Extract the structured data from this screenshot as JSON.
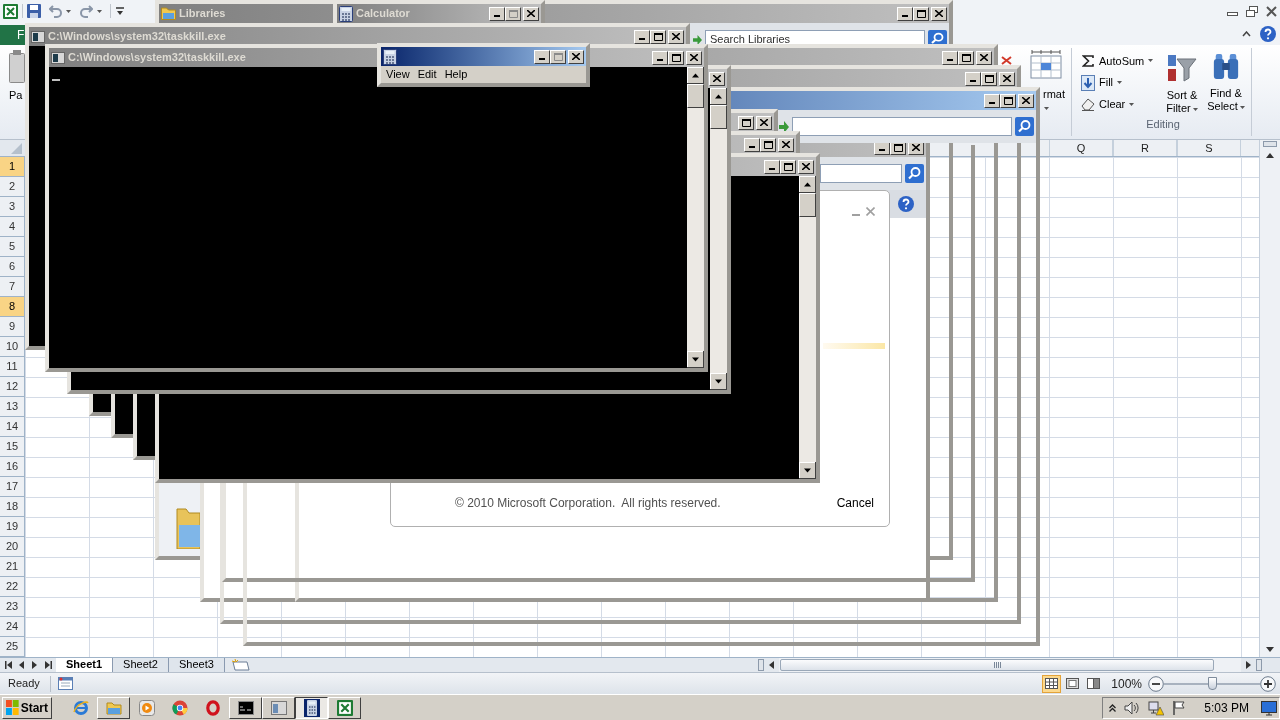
{
  "excel": {
    "file_tab": "F",
    "ribbon": {
      "paste_label": "Pa",
      "format_label": "rmat",
      "editing_items": [
        {
          "kind": "sum",
          "label": "AutoSum"
        },
        {
          "kind": "fill",
          "label": "Fill"
        },
        {
          "kind": "clear",
          "label": "Clear"
        }
      ],
      "editing_buttons": [
        {
          "kind": "sort",
          "lines": [
            "Sort &",
            "Filter"
          ]
        },
        {
          "kind": "find",
          "lines": [
            "Find &",
            "Select"
          ]
        }
      ],
      "group_label": "Editing"
    },
    "columns": [
      "Q",
      "R",
      "S"
    ],
    "rows": [
      {
        "label": "1",
        "selected": true
      },
      {
        "label": "2",
        "selected": false
      },
      {
        "label": "3",
        "selected": false
      },
      {
        "label": "4",
        "selected": false
      },
      {
        "label": "5",
        "selected": false
      },
      {
        "label": "6",
        "selected": false
      },
      {
        "label": "7",
        "selected": false
      },
      {
        "label": "8",
        "selected": true
      },
      {
        "label": "9",
        "selected": false
      },
      {
        "label": "10",
        "selected": false
      },
      {
        "label": "11",
        "selected": false
      },
      {
        "label": "12",
        "selected": false
      },
      {
        "label": "13",
        "selected": false
      },
      {
        "label": "14",
        "selected": false
      },
      {
        "label": "15",
        "selected": false
      },
      {
        "label": "16",
        "selected": false
      },
      {
        "label": "17",
        "selected": false
      },
      {
        "label": "18",
        "selected": false
      },
      {
        "label": "19",
        "selected": false
      },
      {
        "label": "20",
        "selected": false
      },
      {
        "label": "21",
        "selected": false
      },
      {
        "label": "22",
        "selected": false
      },
      {
        "label": "23",
        "selected": false
      },
      {
        "label": "24",
        "selected": false
      },
      {
        "label": "25",
        "selected": false
      }
    ],
    "sheets": [
      {
        "label": "Sheet1",
        "selected": true
      },
      {
        "label": "Sheet2",
        "selected": false
      },
      {
        "label": "Sheet3",
        "selected": false
      }
    ],
    "status": "Ready",
    "views": [
      {
        "kind": "normal",
        "selected": true
      },
      {
        "kind": "page_layout",
        "selected": false
      },
      {
        "kind": "page_break",
        "selected": false
      }
    ],
    "zoom": {
      "reading": "100%",
      "level": 0.5
    }
  },
  "windows": [
    {
      "kind": "explorer",
      "title": "Libraries",
      "active": false,
      "search": {
        "placeholder": "Search Libraries"
      }
    },
    {
      "kind": "calculator",
      "title": "Calculator",
      "active": false
    },
    {
      "kind": "explorer",
      "active": false
    },
    {
      "kind": "explorer",
      "active": false
    },
    {
      "kind": "explorer",
      "active": false
    },
    {
      "kind": "frame"
    },
    {
      "kind": "dialog",
      "footer": "© 2010 Microsoft Corporation.  All rights reserved.",
      "button": "Cancel"
    },
    {
      "kind": "console"
    },
    {
      "kind": "explorer",
      "active": true
    },
    {
      "kind": "console",
      "active": false
    },
    {
      "kind": "console",
      "active": false
    },
    {
      "kind": "console",
      "active": false
    },
    {
      "kind": "console",
      "active": false
    },
    {
      "kind": "console",
      "title": "C:\\Windows\\system32\\taskkill.exe",
      "active": false,
      "cursor": false
    },
    {
      "kind": "console",
      "title": "C:\\Windows\\system32\\taskkill.exe",
      "active": false,
      "cursor": true
    },
    {
      "kind": "calculator",
      "active": true,
      "menu": [
        "View",
        "Edit",
        "Help"
      ]
    }
  ],
  "taskbar": {
    "start": "Start",
    "apps": [
      {
        "kind": "ie",
        "running": false,
        "selected": false
      },
      {
        "kind": "folder",
        "running": true,
        "selected": false
      },
      {
        "kind": "media",
        "running": false,
        "selected": false
      },
      {
        "kind": "chrome",
        "running": false,
        "selected": false
      },
      {
        "kind": "opera",
        "running": false,
        "selected": false
      },
      {
        "kind": "console",
        "running": true,
        "selected": false
      },
      {
        "kind": "window",
        "running": true,
        "selected": false
      },
      {
        "kind": "calculator",
        "running": true,
        "selected": true
      },
      {
        "kind": "spreadsheet",
        "running": true,
        "selected": false
      }
    ],
    "clock": "5:03 PM"
  }
}
